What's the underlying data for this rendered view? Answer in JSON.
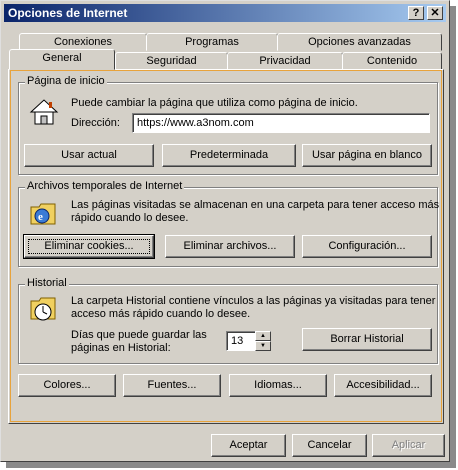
{
  "window": {
    "title": "Opciones de Internet",
    "help_btn": "?",
    "close_btn": "✕"
  },
  "tabs_back": [
    "Conexiones",
    "Programas",
    "Opciones avanzadas"
  ],
  "tabs_front": [
    "General",
    "Seguridad",
    "Privacidad",
    "Contenido"
  ],
  "homepage": {
    "label": "Página de inicio",
    "desc": "Puede cambiar la página que utiliza como página de inicio.",
    "address_label": "Dirección:",
    "address_value": "https://www.a3nom.com",
    "btn_current": "Usar actual",
    "btn_default": "Predeterminada",
    "btn_blank": "Usar página en blanco"
  },
  "temp_files": {
    "label": "Archivos temporales de Internet",
    "desc_line1": "Las páginas visitadas se almacenan en una carpeta para tener acceso más",
    "desc_line2": "rápido cuando lo desee.",
    "btn_cookies": "Eliminar cookies...",
    "btn_files": "Eliminar archivos...",
    "btn_settings": "Configuración..."
  },
  "history": {
    "label": "Historial",
    "desc_line1": "La carpeta Historial contiene vínculos a las páginas ya visitadas para tener",
    "desc_line2": "acceso más rápido cuando lo desee.",
    "days_line1": "Días que puede guardar las",
    "days_line2": "páginas en Historial:",
    "days_value": "13",
    "btn_clear": "Borrar Historial"
  },
  "bottom_buttons": {
    "colors": "Colores...",
    "fonts": "Fuentes...",
    "languages": "Idiomas...",
    "accessibility": "Accesibilidad..."
  },
  "dialog_buttons": {
    "ok": "Aceptar",
    "cancel": "Cancelar",
    "apply": "Aplicar"
  }
}
